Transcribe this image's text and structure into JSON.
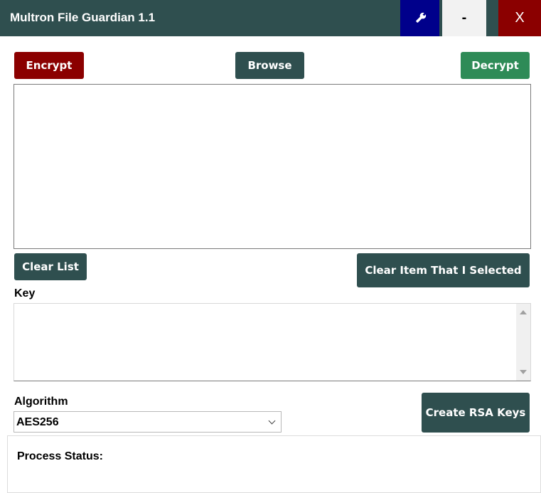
{
  "window": {
    "title": "Multron File Guardian 1.1",
    "minimize_label": "-",
    "close_label": "X",
    "settings_icon": "wrench-icon"
  },
  "toolbar": {
    "encrypt_label": "Encrypt",
    "browse_label": "Browse",
    "decrypt_label": "Decrypt"
  },
  "file_list": {
    "items": [],
    "clear_list_label": "Clear List",
    "clear_item_label": "Clear Item That I Selected"
  },
  "key": {
    "label": "Key",
    "value": ""
  },
  "algorithm": {
    "label": "Algorithm",
    "selected": "AES256"
  },
  "rsa": {
    "button_label": "Create RSA Keys"
  },
  "status": {
    "label": "Process Status:"
  },
  "colors": {
    "titlebar": "#2f4f4f",
    "encrypt": "#8b0000",
    "decrypt": "#2e8b57",
    "settings": "#00008b",
    "close": "#8b0000",
    "primary_button": "#2f4f4f"
  }
}
